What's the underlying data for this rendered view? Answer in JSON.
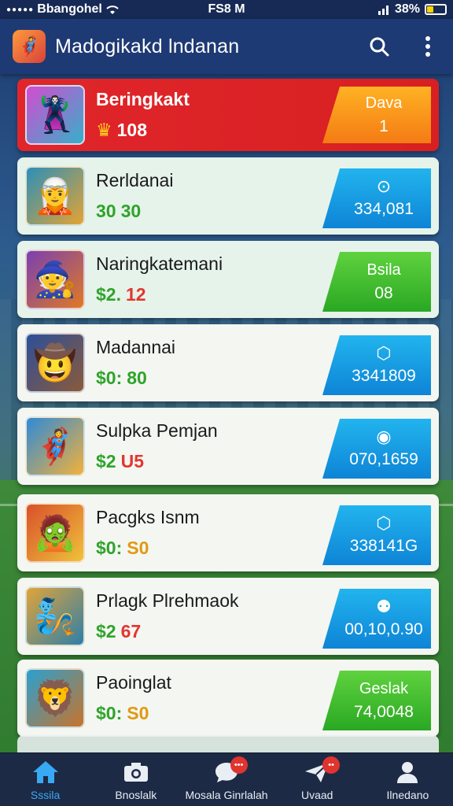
{
  "status_bar": {
    "carrier": "Bbangohel",
    "time": "FS8 M",
    "battery": "38%"
  },
  "app_bar": {
    "title": "Madogikakd lndanan"
  },
  "leaderboard": [
    {
      "name": "Beringkakt",
      "score": "108",
      "badge_line1": "Dava",
      "badge_line2": "1",
      "badge_color": "orange",
      "avatar": "🦹"
    },
    {
      "name": "Rerldanai",
      "score_a": "30",
      "score_b": "30",
      "badge_line1": "⊙",
      "badge_line2": "334,081",
      "badge_color": "blue",
      "avatar": "🧝"
    },
    {
      "name": "Naringkatemani",
      "score_a": "$2.",
      "score_b": "12",
      "badge_line1": "Bsila",
      "badge_line2": "08",
      "badge_color": "green",
      "avatar": "🧙"
    },
    {
      "name": "Madannai",
      "score_a": "$0:",
      "score_b": "80",
      "badge_line1": "⬡",
      "badge_line2": "3341809",
      "badge_color": "blue",
      "avatar": "🤠"
    },
    {
      "name": "Sulpka Pemjan",
      "score_a": "$2",
      "score_b": "U5",
      "badge_line1": "◉",
      "badge_line2": "070,1659",
      "badge_color": "blue",
      "avatar": "🦸"
    },
    {
      "name": "Pacgks Isnm",
      "score_a": "$0:",
      "score_b": "S0",
      "badge_line1": "⬡",
      "badge_line2": "338141G",
      "badge_color": "blue",
      "avatar": "🧟"
    },
    {
      "name": "Prlagk Plrehmaok",
      "score_a": "$2",
      "score_b": "67",
      "badge_line1": "⚉",
      "badge_line2": "00,10,0.90",
      "badge_color": "blue",
      "avatar": "🧞"
    },
    {
      "name": "Paoinglat",
      "score_a": "$0:",
      "score_b": "S0",
      "badge_line1": "Geslak",
      "badge_line2": "74,0048",
      "badge_color": "green",
      "avatar": "🦁"
    }
  ],
  "bottom_nav": [
    {
      "label": "Sssila",
      "icon": "home-icon",
      "active": true
    },
    {
      "label": "Bnoslalk",
      "icon": "camera-icon",
      "active": false
    },
    {
      "label": "Mosala Ginrlalah",
      "icon": "chat-icon",
      "active": false
    },
    {
      "label": "Uvaad",
      "icon": "send-icon",
      "active": false
    },
    {
      "label": "Ilnedano",
      "icon": "profile-icon",
      "active": false
    }
  ],
  "colors": {
    "accent": "#38a9f5",
    "top_row": "#e0262a",
    "app_bar": "#1e3a74"
  }
}
